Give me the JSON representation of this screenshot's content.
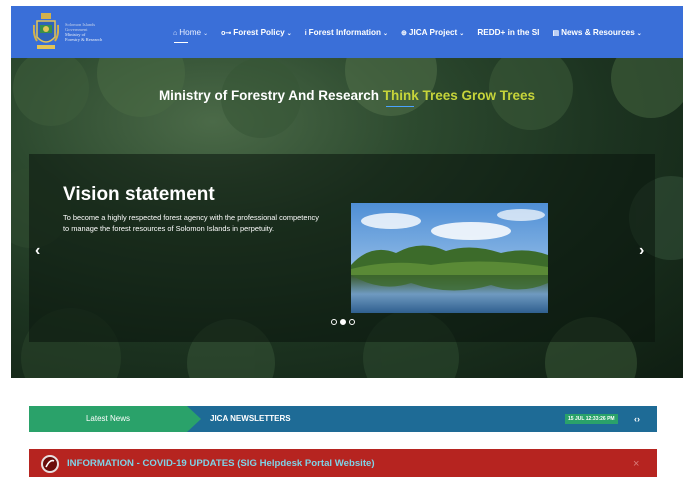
{
  "site": {
    "logo_line1": "Ministry of",
    "logo_line2": "Forestry & Research",
    "logo_top": "Solomon Islands Government"
  },
  "nav": {
    "items": [
      {
        "icon": "home-icon",
        "glyph": "⌂",
        "label": "Home",
        "caret": "⌄"
      },
      {
        "icon": "key-icon",
        "glyph": "o⊸",
        "label": "Forest Policy",
        "caret": "⌄"
      },
      {
        "icon": "info-icon",
        "glyph": "i",
        "label": "Forest Information",
        "caret": "⌄"
      },
      {
        "icon": "globe-icon",
        "glyph": "⊕",
        "label": "JICA Project",
        "caret": "⌄"
      },
      {
        "icon": "",
        "glyph": "",
        "label": "REDD+ in the SI",
        "caret": ""
      },
      {
        "icon": "newspaper-icon",
        "glyph": "▤",
        "label": "News & Resources",
        "caret": "⌄"
      }
    ]
  },
  "hero": {
    "headline_main": "Ministry of Forestry And Research ",
    "headline_accent": "Think Trees Grow Trees",
    "slide_title": "Vision statement",
    "slide_text": "To become a highly respected forest agency with the professional competency to manage the forest resources of Solomon Islands in perpetuity.",
    "prev_glyph": "‹",
    "next_glyph": "›",
    "active_slide": 2,
    "total_slides": 3
  },
  "ticker": {
    "label": "Latest News",
    "headline": "JICA NEWSLETTERS",
    "timestamp": "15 JUL 12:33:26 PM",
    "nav_glyph": "‹›"
  },
  "alert": {
    "text": "INFORMATION - COVID-19 UPDATES (SIG Helpdesk Portal Website)",
    "close_glyph": "×"
  },
  "colors": {
    "navbar": "#3a6fd8",
    "accent_headline": "#c6d43a",
    "ticker_green": "#2aa26a",
    "ticker_blue": "#1e6b96",
    "alert_red": "#b62420",
    "alert_text": "#7fd3e6"
  }
}
